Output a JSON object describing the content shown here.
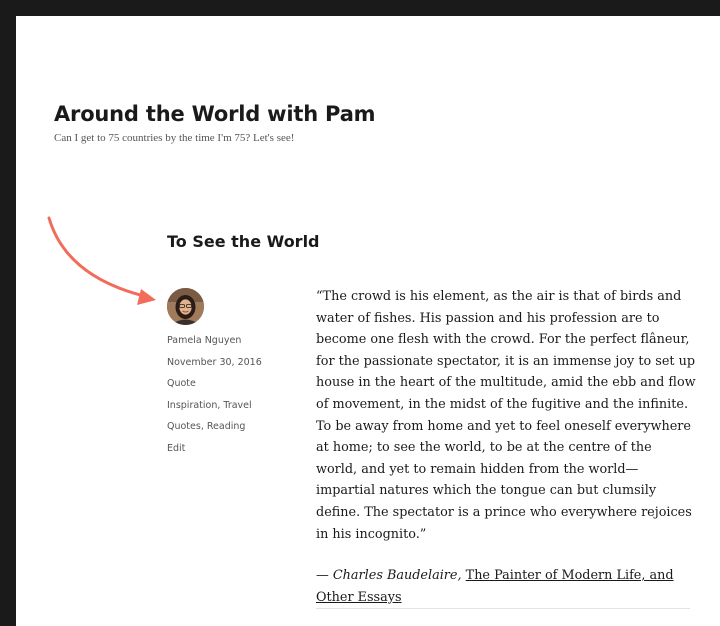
{
  "site": {
    "title": "Around the World with Pam",
    "description": "Can I get to 75 countries by the time I'm 75? Let's see!"
  },
  "post": {
    "title": "To See the World",
    "meta": {
      "author": "Pamela Nguyen",
      "date": "November 30, 2016",
      "format": "Quote",
      "categories": "Inspiration, Travel",
      "tags": "Quotes, Reading",
      "edit": "Edit"
    },
    "quote": "“The crowd is his element, as the air is that of birds and water of fishes. His passion and his profession are to become one flesh with the crowd. For the perfect flâneur, for the passionate spectator, it is an immense joy to set up house in the heart of the multitude, amid the ebb and flow of movement, in the midst of the fugitive and the infinite. To be away from home and yet to feel oneself everywhere at home; to see the world, to be at the centre of the world, and yet to remain hidden from the world—impartial natures which the tongue can but clumsily define. The spectator is a prince who everywhere rejoices in his incognito.”",
    "citation": {
      "prefix": "— ",
      "author": "Charles Baudelaire,",
      "work": "The Painter of Modern Life, and Other Essays"
    }
  },
  "annotation": {
    "arrow_color": "#f26b5b"
  },
  "avatar_icon": "person-photo"
}
